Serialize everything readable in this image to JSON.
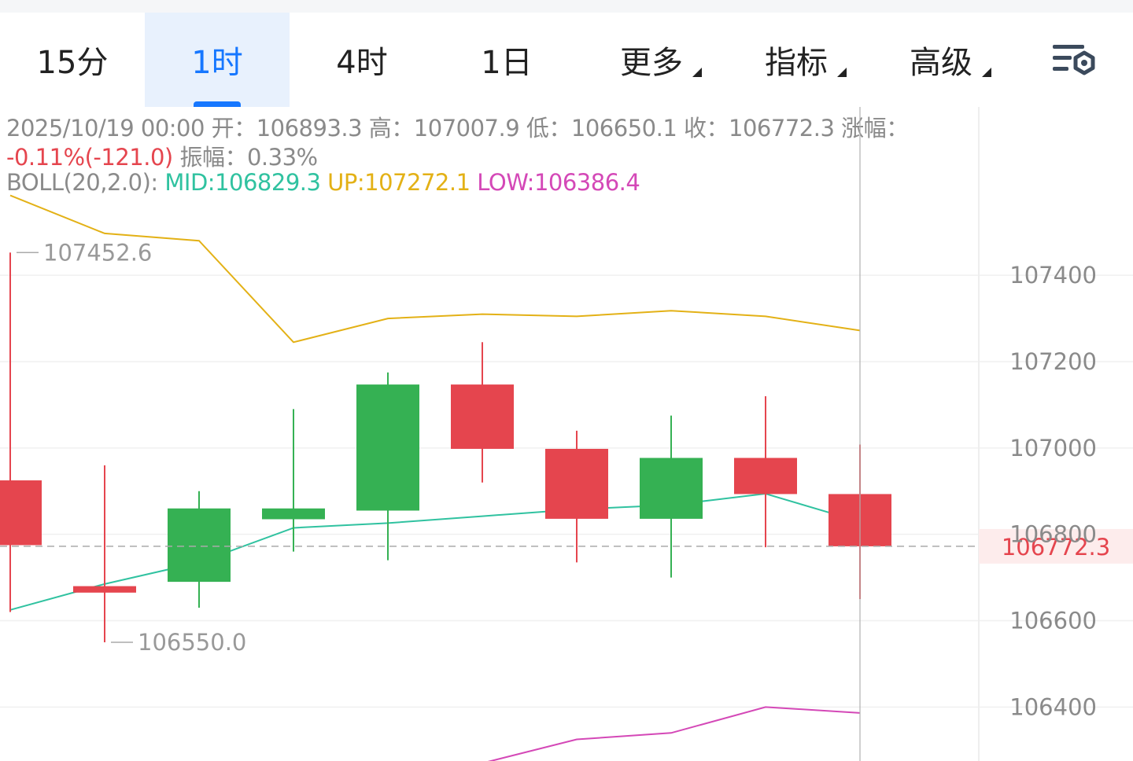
{
  "tabs": [
    {
      "label": "15分",
      "active": false,
      "dropdown": false
    },
    {
      "label": "1时",
      "active": true,
      "dropdown": false
    },
    {
      "label": "4时",
      "active": false,
      "dropdown": false
    },
    {
      "label": "1日",
      "active": false,
      "dropdown": false
    },
    {
      "label": "更多",
      "active": false,
      "dropdown": true
    },
    {
      "label": "指标",
      "active": false,
      "dropdown": true
    },
    {
      "label": "高级",
      "active": false,
      "dropdown": true
    }
  ],
  "settings_icon": "chart-settings-icon",
  "info": {
    "datetime": "2025/10/19 00:00",
    "open_label": "开：",
    "open": "106893.3",
    "high_label": "高：",
    "high": "107007.9",
    "low_label": "低：",
    "low": "106650.1",
    "close_label": "收：",
    "close": "106772.3",
    "change_label": "涨幅：",
    "change": "-0.11%(-121.0)",
    "amplitude_label": "振幅：",
    "amplitude": "0.33%",
    "boll_label": "BOLL(20,2.0):",
    "boll_mid": "MID:106829.3",
    "boll_up": "UP:107272.1",
    "boll_low": "LOW:106386.4"
  },
  "colors": {
    "up": "#35b153",
    "down": "#e5454e",
    "mid": "#30c2a0",
    "upper": "#e3b116",
    "lower": "#d448b7",
    "accent": "#1677ff"
  },
  "chart_data": {
    "type": "candlestick",
    "ylim": [
      106275,
      107790
    ],
    "y_ticks": [
      "107400",
      "107200",
      "107000",
      "106800",
      "106600",
      "106400"
    ],
    "last_price_label": "106772.3",
    "max_label": "107452.6",
    "min_label": "106550.0",
    "candles": [
      {
        "open": 106925,
        "high": 107452.6,
        "low": 106620,
        "close": 106775
      },
      {
        "open": 106680,
        "high": 106960,
        "low": 106550.0,
        "close": 106665
      },
      {
        "open": 106690,
        "high": 106900,
        "low": 106630,
        "close": 106860
      },
      {
        "open": 106835,
        "high": 107090,
        "low": 106760,
        "close": 106860
      },
      {
        "open": 106855,
        "high": 107175,
        "low": 106740,
        "close": 107147
      },
      {
        "open": 107147,
        "high": 107245,
        "low": 106920,
        "close": 106998
      },
      {
        "open": 106998,
        "high": 107040,
        "low": 106735,
        "close": 106836
      },
      {
        "open": 106836,
        "high": 107075,
        "low": 106700,
        "close": 106977
      },
      {
        "open": 106977,
        "high": 107120,
        "low": 106770,
        "close": 106893.3
      },
      {
        "open": 106893.3,
        "high": 107007.9,
        "low": 106650.1,
        "close": 106772.3
      }
    ],
    "boll": {
      "upper": [
        107585,
        107497,
        107480,
        107245,
        107300,
        107310,
        107305,
        107318,
        107305,
        107272.1
      ],
      "mid": [
        106625,
        106685,
        106735,
        106815,
        106826,
        106842,
        106858,
        106868,
        106894,
        106829.3
      ],
      "lower": [
        null,
        null,
        null,
        null,
        null,
        106270,
        106325,
        106340,
        106400,
        106386.4
      ]
    }
  }
}
